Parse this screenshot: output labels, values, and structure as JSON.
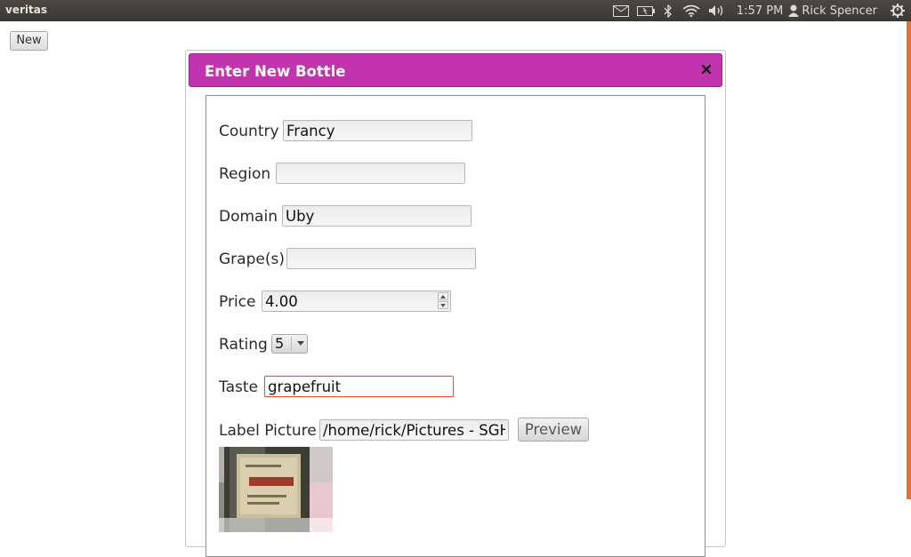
{
  "panel": {
    "app_title": "veritas",
    "clock": "1:57 PM",
    "user": "Rick Spencer",
    "icons": [
      "mail-icon",
      "battery-icon",
      "bluetooth-icon",
      "wifi-icon",
      "volume-icon",
      "user-icon",
      "power-gear-icon"
    ]
  },
  "page": {
    "new_label": "New"
  },
  "dialog": {
    "title": "Enter New Bottle",
    "close_icon": "close-icon",
    "fields": {
      "country": {
        "label": "Country",
        "value": "Francy"
      },
      "region": {
        "label": "Region",
        "value": ""
      },
      "domain": {
        "label": "Domain",
        "value": "Uby"
      },
      "grapes": {
        "label": "Grape(s)",
        "value": ""
      },
      "price": {
        "label": "Price",
        "value": "4.00"
      },
      "rating": {
        "label": "Rating",
        "value": "5"
      },
      "taste": {
        "label": "Taste",
        "value": "grapefruit"
      },
      "label_picture": {
        "label": "Label Picture",
        "value": "/home/rick/Pictures - SGH"
      }
    },
    "preview_label": "Preview"
  },
  "colors": {
    "title_bar": "#c233ae",
    "focus_border": "#e05a2b",
    "panel_bg": "#3c3b37",
    "accent_strip": "#e8712f"
  }
}
